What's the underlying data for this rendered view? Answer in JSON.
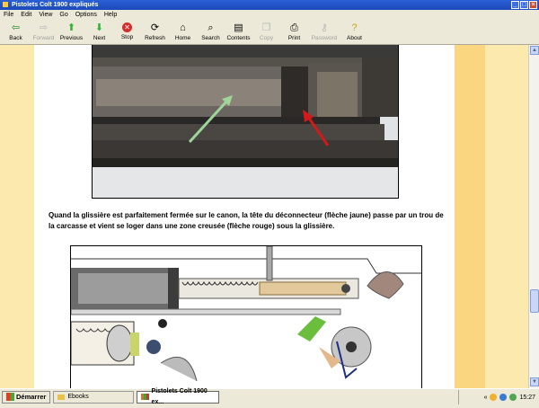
{
  "window": {
    "title": "Pistolets Colt 1900 expliqués"
  },
  "menu": [
    "File",
    "Edit",
    "View",
    "Go",
    "Options",
    "Help"
  ],
  "toolbar": [
    {
      "label": "Back",
      "icon": "back-arrow-icon",
      "enabled": true
    },
    {
      "label": "Forward",
      "icon": "forward-arrow-icon",
      "enabled": false
    },
    {
      "label": "Previous",
      "icon": "up-arrow-icon",
      "enabled": true
    },
    {
      "label": "Next",
      "icon": "down-arrow-icon",
      "enabled": true
    },
    {
      "label": "Stop",
      "icon": "stop-icon",
      "enabled": true
    },
    {
      "label": "Refresh",
      "icon": "refresh-icon",
      "enabled": true
    },
    {
      "label": "Home",
      "icon": "home-icon",
      "enabled": true
    },
    {
      "label": "Search",
      "icon": "search-icon",
      "enabled": true
    },
    {
      "label": "Contents",
      "icon": "contents-icon",
      "enabled": true
    },
    {
      "label": "Copy",
      "icon": "copy-icon",
      "enabled": false
    },
    {
      "label": "Print",
      "icon": "print-icon",
      "enabled": true
    },
    {
      "label": "Password",
      "icon": "key-icon",
      "enabled": false
    },
    {
      "label": "About",
      "icon": "about-icon",
      "enabled": true
    }
  ],
  "content": {
    "caption": "Quand la glissière est parfaitement fermée sur le canon, la tête du déconnecteur (flèche jaune) passe par un trou de la carcasse et vient se loger dans une zone creusée (flèche rouge) sous la glissière."
  },
  "taskbar": {
    "start_label": "Démarrer",
    "items": [
      {
        "label": "Ebooks",
        "active": false
      },
      {
        "label": "Pistolets Colt 1900 ex...",
        "active": true
      }
    ],
    "clock": "15:27"
  },
  "colors": {
    "page_bg": "#fbe9ad",
    "strip": "#f9d67f",
    "titlebar": "#2a5fd6"
  }
}
